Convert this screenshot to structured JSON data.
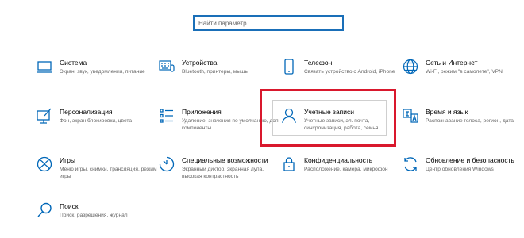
{
  "search": {
    "placeholder": "Найти параметр"
  },
  "tiles": [
    {
      "title": "Система",
      "desc": "Экран, звук, уведомления, питание",
      "icon": "laptop-icon"
    },
    {
      "title": "Устройства",
      "desc": "Bluetooth, принтеры, мышь",
      "icon": "keyboard-icon"
    },
    {
      "title": "Телефон",
      "desc": "Связать устройство с Android, iPhone",
      "icon": "phone-icon"
    },
    {
      "title": "Сеть и Интернет",
      "desc": "Wi-Fi, режим \"в самолете\", VPN",
      "icon": "globe-icon"
    },
    {
      "title": "Персонализация",
      "desc": "Фон, экран блокировки, цвета",
      "icon": "personalization-icon"
    },
    {
      "title": "Приложения",
      "desc": "Удаление, значения по умолчанию, доп. компоненты",
      "icon": "apps-list-icon"
    },
    {
      "title": "Учетные записи",
      "desc": "Учетные записи, эл. почта, синхронизация, работа, семья",
      "icon": "user-icon"
    },
    {
      "title": "Время и язык",
      "desc": "Распознавание голоса, регион, дата",
      "icon": "time-language-icon"
    },
    {
      "title": "Игры",
      "desc": "Меню игры, снимки, трансляция, режим игры",
      "icon": "xbox-icon"
    },
    {
      "title": "Специальные возможности",
      "desc": "Экранный диктор, экранная лупа, высокая контрастность",
      "icon": "accessibility-icon"
    },
    {
      "title": "Конфиденциальность",
      "desc": "Расположение, камера, микрофон",
      "icon": "lock-icon"
    },
    {
      "title": "Обновление и безопасность",
      "desc": "Центр обновления Windows",
      "icon": "update-icon"
    },
    {
      "title": "Поиск",
      "desc": "Поиск, разрешения, журнал",
      "icon": "search-icon"
    }
  ],
  "colors": {
    "accent": "#1a6fb8",
    "highlight": "#d9182d",
    "icon": "#0067b8"
  }
}
